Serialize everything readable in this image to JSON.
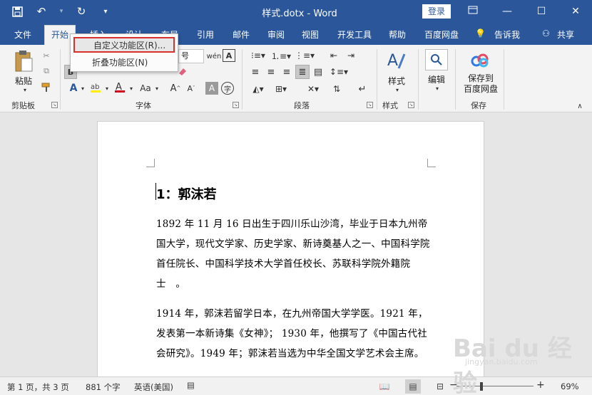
{
  "titlebar": {
    "title": "样式.dotx  -  Word",
    "login": "登录",
    "icons": [
      "save-icon",
      "undo-icon",
      "redo-icon",
      "customize-qat-icon"
    ],
    "controls": [
      "minimize-icon",
      "restore-icon",
      "close-icon"
    ]
  },
  "tabs": [
    {
      "label": "文件"
    },
    {
      "label": "开始"
    },
    {
      "label": "插入"
    },
    {
      "label": "设计"
    },
    {
      "label": "布局"
    },
    {
      "label": "引用"
    },
    {
      "label": "邮件"
    },
    {
      "label": "审阅"
    },
    {
      "label": "视图"
    },
    {
      "label": "开发工具"
    },
    {
      "label": "帮助"
    },
    {
      "label": "百度网盘"
    },
    {
      "label": "告诉我"
    },
    {
      "label": "共享"
    }
  ],
  "context_menu": {
    "items": [
      {
        "label": "自定义功能区(R)..."
      },
      {
        "label": "折叠功能区(N)"
      }
    ]
  },
  "ribbon": {
    "clipboard": {
      "paste": "粘贴",
      "label": "剪贴板"
    },
    "font": {
      "size": "号",
      "label": "字体"
    },
    "paragraph": {
      "label": "段落"
    },
    "styles": {
      "button": "样式",
      "label": "样式"
    },
    "editing": {
      "button": "编辑"
    },
    "save": {
      "button_line1": "保存到",
      "button_line2": "百度网盘",
      "label": "保存"
    }
  },
  "document": {
    "heading": "1：郭沫若",
    "paragraphs": [
      "1892 年 11 月 16 日出生于四川乐山沙湾，毕业于日本九州帝国大学，现代文学家、历史学家、新诗奠基人之一、中国科学院首任院长、中国科学技术大学首任校长、苏联科学院外籍院士　。",
      "1914 年，郭沫若留学日本，在九州帝国大学学医。1921 年，发表第一本新诗集《女神》； 1930 年，他撰写了《中国古代社会研究》。1949 年；郭沫若当选为中华全国文学艺术会主席。"
    ]
  },
  "statusbar": {
    "page": "第 1 页，共 3 页",
    "words": "881 个字",
    "language": "英语(美国)",
    "zoom": "69%",
    "zoom_level": 0.69
  },
  "watermark": {
    "text": "Bai du 经验",
    "sub": "jingyan.baidu.com"
  }
}
